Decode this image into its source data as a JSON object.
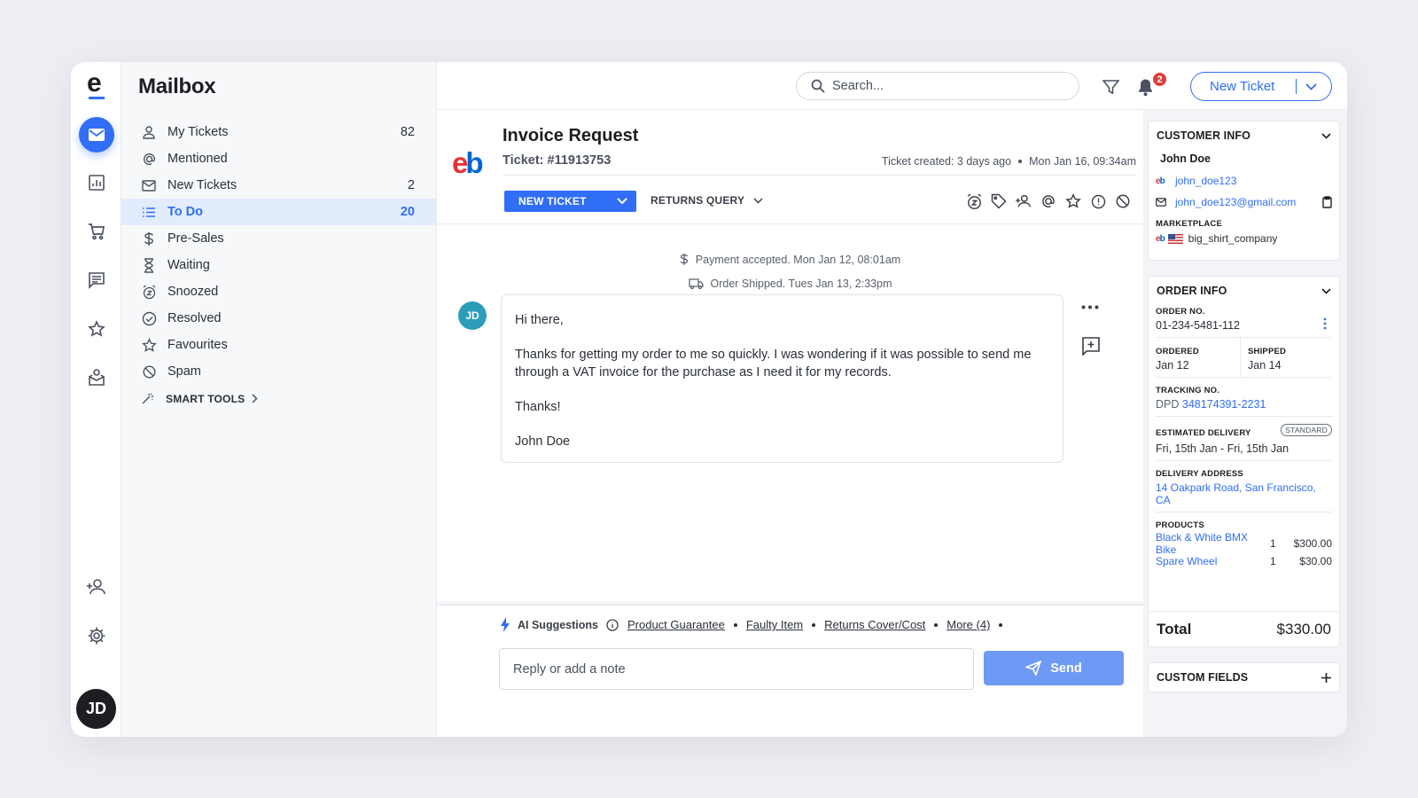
{
  "app": {
    "logo_letter": "e"
  },
  "rail": {
    "items": [
      "mail-icon",
      "analytics-icon",
      "cart-icon",
      "chat-icon",
      "star-icon",
      "inbox-icon",
      "add-user-icon",
      "settings-icon"
    ],
    "avatar": "JD"
  },
  "mailbox": {
    "title": "Mailbox",
    "folders": [
      {
        "label": "My Tickets",
        "count": "82"
      },
      {
        "label": "Mentioned",
        "count": ""
      },
      {
        "label": "New Tickets",
        "count": "2"
      },
      {
        "label": "To Do",
        "count": "20"
      },
      {
        "label": "Pre-Sales",
        "count": ""
      },
      {
        "label": "Waiting",
        "count": ""
      },
      {
        "label": "Snoozed",
        "count": ""
      },
      {
        "label": "Resolved",
        "count": ""
      },
      {
        "label": "Favourites",
        "count": ""
      },
      {
        "label": "Spam",
        "count": ""
      }
    ],
    "smart_tools": "SMART TOOLS"
  },
  "topbar": {
    "search_placeholder": "Search...",
    "notification_count": "2",
    "new_ticket_label": "New Ticket"
  },
  "ticket": {
    "logo_e": "e",
    "logo_b": "b",
    "title": "Invoice Request",
    "number": "Ticket: #11913753",
    "created": "Ticket created: 3 days ago",
    "created_date": "Mon Jan 16, 09:34am",
    "status": "NEW TICKET",
    "category": "RETURNS QUERY",
    "events": [
      "Payment accepted. Mon Jan 12, 08:01am",
      "Order Shipped. Tues Jan 13, 2:33pm"
    ],
    "message": {
      "avatar": "JD",
      "greeting": "Hi there,",
      "body": "Thanks for getting my order to me so quickly. I was wondering if it was possible to send me through a VAT invoice for the purchase as I need it for my records.",
      "thanks": "Thanks!",
      "signature": "John Doe"
    }
  },
  "composer": {
    "ai_label": "AI Suggestions",
    "suggestions": [
      "Product Guarantee",
      "Faulty Item",
      "Returns Cover/Cost",
      "More (4)"
    ],
    "reply_placeholder": "Reply or add a note",
    "send_label": "Send"
  },
  "customer": {
    "heading": "CUSTOMER INFO",
    "name": "John Doe",
    "username": "john_doe123",
    "email": "john_doe123@gmail.com",
    "marketplace_label": "MARKETPLACE",
    "marketplace_store": "big_shirt_company"
  },
  "order": {
    "heading": "ORDER INFO",
    "order_no_label": "ORDER NO.",
    "order_no": "01-234-5481-112",
    "ordered_label": "ORDERED",
    "ordered": "Jan 12",
    "shipped_label": "SHIPPED",
    "shipped": "Jan 14",
    "tracking_label": "TRACKING NO.",
    "carrier": "DPD",
    "tracking_no": "348174391-2231",
    "delivery_label": "ESTIMATED DELIVERY",
    "delivery_badge": "STANDARD",
    "delivery": "Fri, 15th Jan - Fri, 15th Jan",
    "address_label": "DELIVERY ADDRESS",
    "address": "14 Oakpark Road, San Francisco, CA",
    "products_label": "PRODUCTS",
    "products": [
      {
        "name": "Black & White BMX Bike",
        "qty": "1",
        "price": "$300.00"
      },
      {
        "name": "Spare Wheel",
        "qty": "1",
        "price": "$30.00"
      }
    ],
    "total_label": "Total",
    "total": "$330.00"
  },
  "custom_fields": {
    "heading": "CUSTOM FIELDS"
  },
  "colors": {
    "accent": "#2f6ef5",
    "badge": "#e23c3c",
    "send": "#6e9af5"
  }
}
